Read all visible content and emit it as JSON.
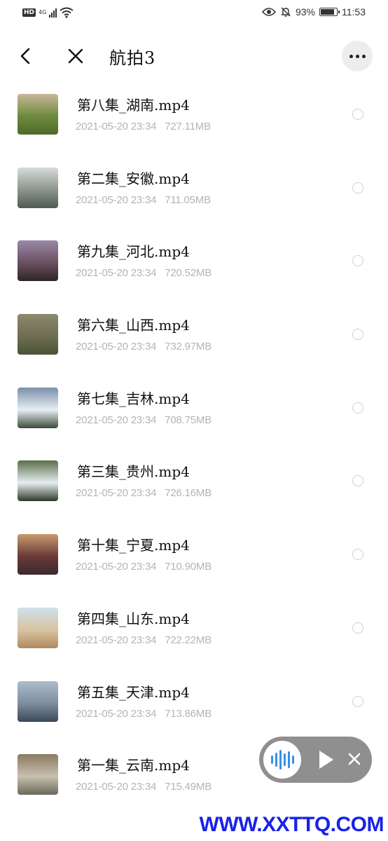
{
  "status_bar": {
    "hd_label": "HD",
    "network": "4G",
    "battery_percent": "93%",
    "battery_level": 0.93,
    "time": "11:53"
  },
  "header": {
    "title": "航拍3",
    "icons": {
      "back": "back-arrow-icon",
      "close": "close-icon",
      "more": "more-icon"
    }
  },
  "files": [
    {
      "name": "第八集_湖南.mp4",
      "date": "2021-05-20 23:34",
      "size": "727.11MB",
      "thumb_colors": [
        "#c9b89a",
        "#6d8a3c",
        "#4e6b2a"
      ]
    },
    {
      "name": "第二集_安徽.mp4",
      "date": "2021-05-20 23:34",
      "size": "711.05MB",
      "thumb_colors": [
        "#d8dcd8",
        "#8a958d",
        "#4f5a52"
      ]
    },
    {
      "name": "第九集_河北.mp4",
      "date": "2021-05-20 23:34",
      "size": "720.52MB",
      "thumb_colors": [
        "#9a8aa8",
        "#6a5060",
        "#2e2528"
      ]
    },
    {
      "name": "第六集_山西.mp4",
      "date": "2021-05-20 23:34",
      "size": "732.97MB",
      "thumb_colors": [
        "#8b8a6e",
        "#6f6e52",
        "#4a5238"
      ]
    },
    {
      "name": "第七集_吉林.mp4",
      "date": "2021-05-20 23:34",
      "size": "708.75MB",
      "thumb_colors": [
        "#7a8fa8",
        "#e8eef4",
        "#3a4a3a"
      ]
    },
    {
      "name": "第三集_贵州.mp4",
      "date": "2021-05-20 23:34",
      "size": "726.16MB",
      "thumb_colors": [
        "#5a6e4a",
        "#e6eef0",
        "#2e3a28"
      ]
    },
    {
      "name": "第十集_宁夏.mp4",
      "date": "2021-05-20 23:34",
      "size": "710.90MB",
      "thumb_colors": [
        "#c89a70",
        "#6a3a38",
        "#3a2a30"
      ]
    },
    {
      "name": "第四集_山东.mp4",
      "date": "2021-05-20 23:34",
      "size": "722.22MB",
      "thumb_colors": [
        "#cfe0ec",
        "#d8c4a0",
        "#b08a60"
      ]
    },
    {
      "name": "第五集_天津.mp4",
      "date": "2021-05-20 23:34",
      "size": "713.86MB",
      "thumb_colors": [
        "#aebccc",
        "#7e8e9e",
        "#3a4858"
      ]
    },
    {
      "name": "第一集_云南.mp4",
      "date": "2021-05-20 23:34",
      "size": "715.49MB",
      "thumb_colors": [
        "#8a7a62",
        "#c8c0b0",
        "#6a6a5a"
      ]
    }
  ],
  "player": {
    "icons": {
      "wave": "audio-wave-icon",
      "play": "play-icon",
      "close": "close-icon"
    },
    "accent_color": "#3a8ee6"
  },
  "watermark": "WWW.XXTTQ.COM"
}
